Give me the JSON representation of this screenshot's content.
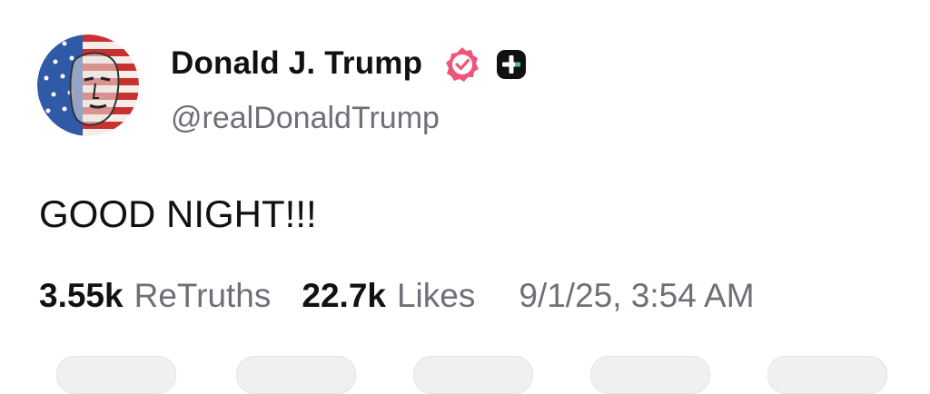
{
  "user": {
    "display_name": "Donald J. Trump",
    "handle": "@realDonaldTrump",
    "avatar_icon": "flag-portrait-avatar",
    "verified_icon": "verified-badge-icon",
    "verified_color": "#f0547b",
    "plus_icon": "truth-plus-badge-icon"
  },
  "post": {
    "text": "GOOD NIGHT!!!"
  },
  "stats": {
    "retruths_count": "3.55k",
    "retruths_label": "ReTruths",
    "likes_count": "22.7k",
    "likes_label": "Likes",
    "timestamp": "9/1/25, 3:54 AM"
  },
  "colors": {
    "text_primary": "#111111",
    "text_secondary": "#6f6f78",
    "background": "#ffffff"
  }
}
